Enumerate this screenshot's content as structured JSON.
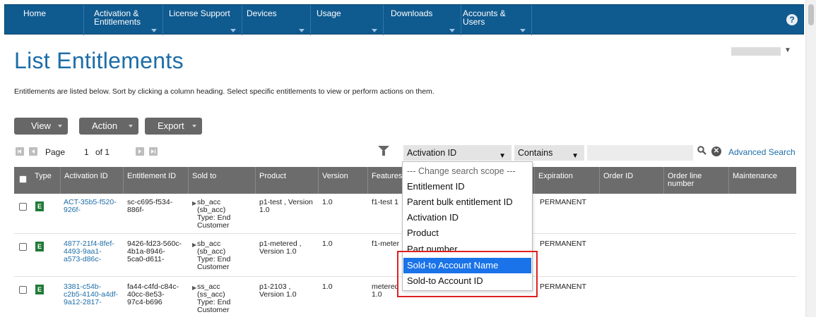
{
  "nav": {
    "items": [
      {
        "label": "Home",
        "caret": false
      },
      {
        "label": "Activation &\nEntitlements",
        "caret": true
      },
      {
        "label": "License Support",
        "caret": true
      },
      {
        "label": "Devices",
        "caret": true
      },
      {
        "label": "Usage",
        "caret": true
      },
      {
        "label": "Downloads",
        "caret": true
      },
      {
        "label": "Accounts &\nUsers",
        "caret": true
      }
    ],
    "help_icon": "?"
  },
  "page": {
    "title": "List Entitlements",
    "intro": "Entitlements are listed below. Sort by clicking a column heading. Select specific entitlements to view or perform actions on them."
  },
  "toolbar": {
    "view_label": "View",
    "action_label": "Action",
    "export_label": "Export"
  },
  "pager": {
    "page_label": "Page",
    "current_page": "1",
    "of_label": "of 1"
  },
  "search": {
    "scope_value": "Activation ID",
    "operator_value": "Contains",
    "query_value": "",
    "advanced_link": "Advanced Search",
    "clear_icon": "✕"
  },
  "table": {
    "headers": [
      "Type",
      "Activation ID",
      "Entitlement ID",
      "Sold to",
      "Product",
      "Version",
      "Features",
      "Expiration",
      "Order ID",
      "Order line\nnumber",
      "Maintenance"
    ],
    "rows": [
      {
        "type_icon": "E",
        "activation_id": "ACT-35b5-f520-\n926f-",
        "entitlement_id": "sc-c695-f534-\n886f-",
        "sold_to": "sb_acc\n(sb_acc)\nType: End\nCustomer",
        "product": "p1-test , Version\n1.0",
        "version": "1.0",
        "features": "f1-test 1",
        "expiration": "PERMANENT"
      },
      {
        "type_icon": "E",
        "activation_id": "4877-21f4-8fef-\n4493-9aa1-\na573-d86c-",
        "entitlement_id": "9426-fd23-560c-\n4b1a-8946-\n5ca0-d611-",
        "sold_to": "sb_acc\n(sb_acc)\nType: End\nCustomer",
        "product": "p1-metered ,\nVersion 1.0",
        "version": "1.0",
        "features": "f1-meter",
        "expiration": "PERMANENT"
      },
      {
        "type_icon": "E",
        "activation_id": "3381-c54b-\nc2b5-4140-a4df-\n9a12-2817-",
        "entitlement_id": "fa44-c4fd-c84c-\n40cc-8e53-\n97c4-b696",
        "sold_to": "ss_acc\n(ss_acc)\nType: End\nCustomer",
        "product": "p1-2103 ,\nVersion 1.0",
        "version": "1.0",
        "features": "metered\n1.0",
        "expiration": "PERMANENT"
      }
    ]
  },
  "dropdown": {
    "options": [
      "--- Change search scope ---",
      "Entitlement ID",
      "Parent bulk entitlement ID",
      "Activation ID",
      "Product",
      "Part number",
      "Sold-to Account Name",
      "Sold-to Account ID"
    ],
    "selected": "Sold-to Account Name"
  },
  "colors": {
    "nav_bg": "#0f5a8f",
    "title": "#1d6da8",
    "highlight": "#e02020",
    "selected_option": "#1a73e8"
  }
}
